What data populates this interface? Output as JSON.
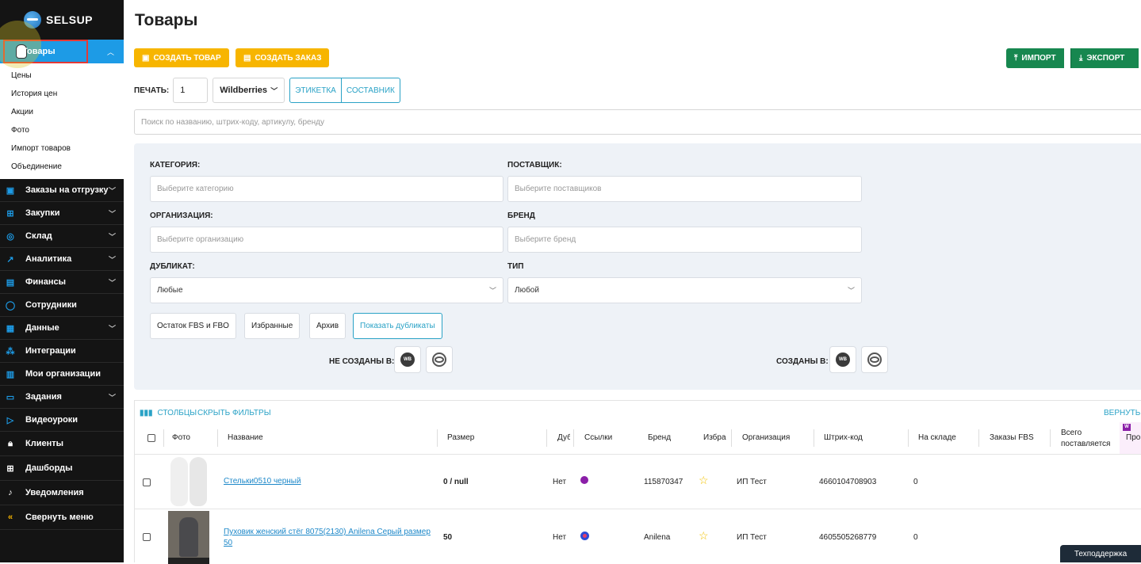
{
  "brand": {
    "name": "SELSUP"
  },
  "sidebar": {
    "active": "Товары",
    "sub": [
      "Цены",
      "История цен",
      "Акции",
      "Фото",
      "Импорт товаров",
      "Объединение"
    ],
    "items": [
      {
        "label": "Заказы на отгрузку",
        "icon": "box-icon",
        "chev": true
      },
      {
        "label": "Закупки",
        "icon": "cart-icon",
        "chev": true
      },
      {
        "label": "Склад",
        "icon": "check-circle-icon",
        "chev": true
      },
      {
        "label": "Аналитика",
        "icon": "chart-line-icon",
        "chev": true
      },
      {
        "label": "Финансы",
        "icon": "wallet-icon",
        "chev": true
      },
      {
        "label": "Сотрудники",
        "icon": "user-icon",
        "chev": false
      },
      {
        "label": "Данные",
        "icon": "document-icon",
        "chev": true
      },
      {
        "label": "Интеграции",
        "icon": "plug-icon",
        "chev": false
      },
      {
        "label": "Мои организации",
        "icon": "bar-chart-icon",
        "chev": false
      },
      {
        "label": "Задания",
        "icon": "task-icon",
        "chev": true
      },
      {
        "label": "Видеоуроки",
        "icon": "video-icon",
        "chev": false
      },
      {
        "label": "Клиенты",
        "icon": "lock-icon",
        "chev": false
      },
      {
        "label": "Дашборды",
        "icon": "grid-icon",
        "chev": false
      },
      {
        "label": "Уведомления",
        "icon": "bell-icon",
        "chev": false
      },
      {
        "label": "Свернуть меню",
        "icon": "collapse-icon",
        "chev": false
      }
    ]
  },
  "page": {
    "title": "Товары"
  },
  "toolbar": {
    "create_product": "СОЗДАТЬ ТОВАР",
    "create_order": "СОЗДАТЬ ЗАКАЗ",
    "import": "ИМПОРТ",
    "export": "ЭКСПОРТ"
  },
  "print": {
    "label": "ПЕЧАТЬ:",
    "qty": "1",
    "marketplace": "Wildberries",
    "label_btn": "ЭТИКЕТКА",
    "composite_btn": "СОСТАВНИК"
  },
  "search": {
    "placeholder": "Поиск по названию, штрих-коду, артикулу, бренду"
  },
  "filters": {
    "category_label": "КАТЕГОРИЯ:",
    "category_ph": "Выберите категорию",
    "supplier_label": "ПОСТАВЩИК:",
    "supplier_ph": "Выберите поставщиков",
    "org_label": "ОРГАНИЗАЦИЯ:",
    "org_ph": "Выберите организацию",
    "brand_label": "БРЕНД",
    "brand_ph": "Выберите бренд",
    "dup_label": "ДУБЛИКАТ:",
    "dup_value": "Любые",
    "type_label": "ТИП",
    "type_value": "Любой",
    "btn_stock": "Остаток FBS и FBO",
    "btn_fav": "Избранные",
    "btn_archive": "Архив",
    "btn_dups": "Показать дубликаты",
    "not_created": "НЕ СОЗДАНЫ В:",
    "created": "СОЗДАНЫ В:",
    "wb": "WB"
  },
  "table": {
    "columns_btn": "СТОЛБЦЫ",
    "hide_filters": "СКРЫТЬ ФИЛЬТРЫ",
    "return": "ВЕРНУТЬ",
    "headers": {
      "photo": "Фото",
      "name": "Название",
      "size": "Размер",
      "dup": "Дуб",
      "links": "Ссылки",
      "brand": "Бренд",
      "fav": "Избра",
      "org": "Организация",
      "barcode": "Штрих-код",
      "stock": "На складе",
      "fbs": "Заказы FBS",
      "total1": "Всего",
      "total2": "поставляется",
      "pro": "Про"
    },
    "rows": [
      {
        "name": "Стельки0510 черный",
        "size": "0 / null",
        "dup": "Нет",
        "brand": "115870347",
        "org": "ИП Тест",
        "barcode": "4660104708903",
        "stock": "0"
      },
      {
        "name": "Пуховик женский стёг 8075(2130) Anilena Серый размер 50",
        "size": "50",
        "dup": "Нет",
        "brand": "Anilena",
        "org": "ИП Тест",
        "barcode": "4605505268779",
        "stock": "0"
      }
    ]
  },
  "support": "Техподдержка",
  "colors": {
    "accent": "#1d9be6",
    "yellow": "#f7b500",
    "green": "#17874f",
    "sidebar": "#141414"
  }
}
